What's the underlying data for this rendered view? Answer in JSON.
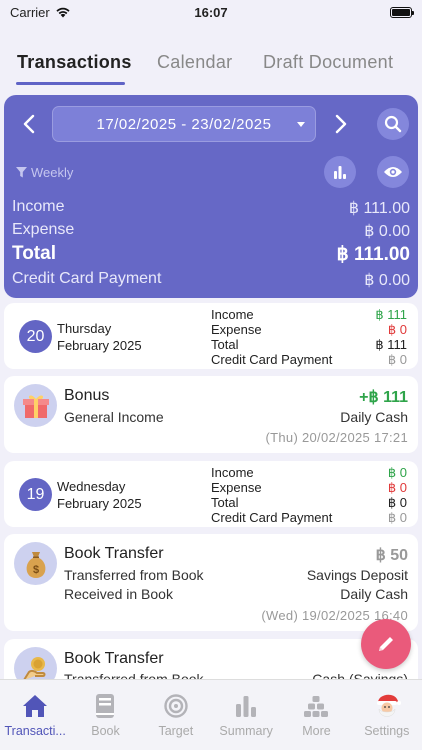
{
  "status_bar": {
    "carrier": "Carrier",
    "time": "16:07"
  },
  "tabs": [
    {
      "label": "Transactions",
      "active": true
    },
    {
      "label": "Calendar",
      "active": false
    },
    {
      "label": "Draft Document",
      "active": false
    }
  ],
  "summary": {
    "date_range": "17/02/2025 - 23/02/2025",
    "period": "Weekly",
    "rows": [
      {
        "label": "Income",
        "value": "฿ 111.00"
      },
      {
        "label": "Expense",
        "value": "฿ 0.00"
      },
      {
        "label": "Total",
        "value": "฿ 111.00"
      },
      {
        "label": "Credit Card Payment",
        "value": "฿ 0.00"
      }
    ]
  },
  "days": [
    {
      "day": "20",
      "weekday": "Thursday",
      "month_year": "February 2025",
      "labels": [
        "Income",
        "Expense",
        "Total",
        "Credit Card Payment"
      ],
      "values": [
        "฿ 111",
        "฿ 0",
        "฿ 111",
        "฿ 0"
      ]
    },
    {
      "day": "19",
      "weekday": "Wednesday",
      "month_year": "February 2025",
      "labels": [
        "Income",
        "Expense",
        "Total",
        "Credit Card Payment"
      ],
      "values": [
        "฿ 0",
        "฿ 0",
        "฿ 0",
        "฿ 0"
      ]
    }
  ],
  "transactions": [
    {
      "icon": "gift-icon",
      "title": "Bonus",
      "subtitle": "General Income",
      "amount": "+฿ 111",
      "account": "Daily Cash",
      "datetime": "(Thu) 20/02/2025  17:21"
    },
    {
      "icon": "money-bag-icon",
      "title": "Book Transfer",
      "subtitle1": "Transferred from Book",
      "subtitle2": "Received in Book",
      "amount": "฿ 50",
      "account1": "Savings Deposit",
      "account2": "Daily Cash",
      "datetime": "(Wed) 19/02/2025  16:40"
    },
    {
      "icon": "hand-coin-icon",
      "title": "Book Transfer",
      "subtitle1": "Transferred from Book",
      "account1": "Cash (Savings)"
    }
  ],
  "bottom_nav": [
    {
      "label": "Transacti...",
      "icon": "home-icon",
      "active": true
    },
    {
      "label": "Book",
      "icon": "book-icon",
      "active": false
    },
    {
      "label": "Target",
      "icon": "target-icon",
      "active": false
    },
    {
      "label": "Summary",
      "icon": "bar-chart-icon",
      "active": false
    },
    {
      "label": "More",
      "icon": "stack-icon",
      "active": false
    },
    {
      "label": "Settings",
      "icon": "santa-icon",
      "active": false
    }
  ],
  "colors": {
    "accent": "#6668c6",
    "income": "#2fa44a",
    "expense": "#e03a3a",
    "fab": "#ea5a7b"
  }
}
